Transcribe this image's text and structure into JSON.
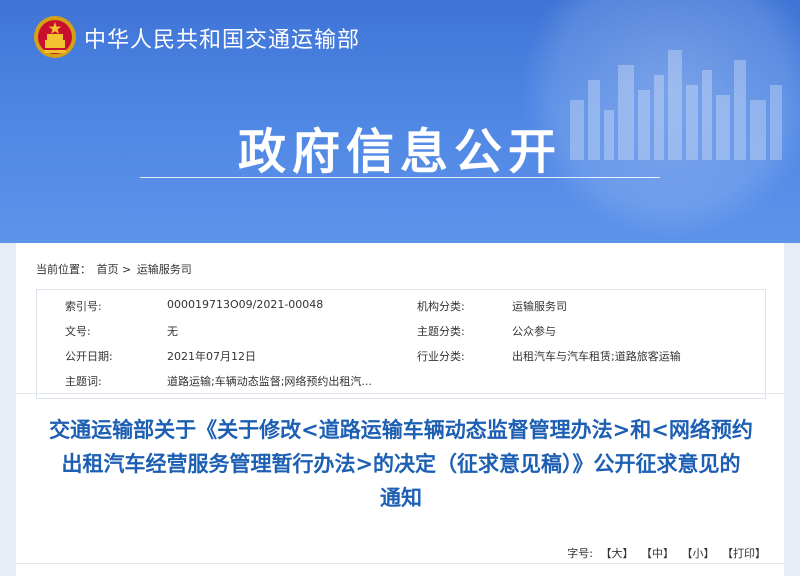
{
  "header": {
    "ministry_name": "中华人民共和国交通运输部",
    "banner_title": "政府信息公开"
  },
  "breadcrumb": {
    "label": "当前位置：",
    "home": "首页",
    "separator": ">",
    "current": "运输服务司"
  },
  "meta": {
    "rows": [
      {
        "k1": "索引号:",
        "v1": "000019713O09/2021-00048",
        "k2": "机构分类:",
        "v2": "运输服务司"
      },
      {
        "k1": "文号:",
        "v1": "无",
        "k2": "主题分类:",
        "v2": "公众参与"
      },
      {
        "k1": "公开日期:",
        "v1": "2021年07月12日",
        "k2": "行业分类:",
        "v2": "出租汽车与汽车租赁;道路旅客运输"
      },
      {
        "k1": "主题词:",
        "v1": "道路运输;车辆动态监督;网络预约出租汽...",
        "k2": "",
        "v2": ""
      }
    ]
  },
  "document": {
    "title_line1": "交通运输部关于《关于修改<道路运输车辆动态监督管理办法>和<网络预约",
    "title_line2": "出租汽车经营服务管理暂行办法>的决定（征求意见稿）》公开征求意见的",
    "title_line3": "通知"
  },
  "font_tools": {
    "label": "字号:",
    "large": "【大】",
    "medium": "【中】",
    "small": "【小】",
    "print": "【打印】"
  },
  "colors": {
    "banner": "#4e86e4",
    "title": "#1d5fb3"
  }
}
